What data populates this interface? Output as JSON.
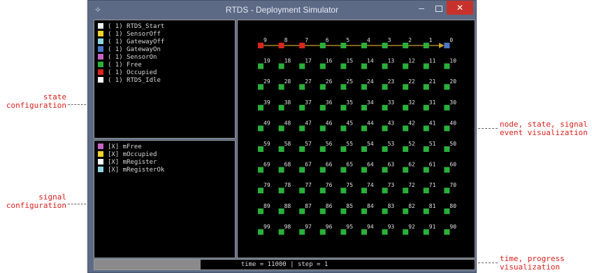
{
  "window": {
    "title": "RTDS - Deployment Simulator"
  },
  "annotations": {
    "state_config": [
      "state",
      "configuration"
    ],
    "signal_config": [
      "signal",
      "configuration"
    ],
    "node_viz": [
      "node, state, signal",
      "event visualization"
    ],
    "time_viz": [
      "time, progress",
      "visualization"
    ]
  },
  "states": [
    {
      "label": "( 1) RTDS_Start",
      "color": "#f2f2f2"
    },
    {
      "label": "( 1) SensorOff",
      "color": "#f2d32b"
    },
    {
      "label": "( 1) GatewayOff",
      "color": "#8ed5e0"
    },
    {
      "label": "( 1) GatewayOn",
      "color": "#4c77c9"
    },
    {
      "label": "( 1) SensorOn",
      "color": "#c564c5"
    },
    {
      "label": "( 1) Free",
      "color": "#29b13a"
    },
    {
      "label": "( 1) Occupied",
      "color": "#d8261d"
    },
    {
      "label": "( 1) RTDS_Idle",
      "color": "#ffffff"
    }
  ],
  "signals": [
    {
      "label": "[X] mFree",
      "color": "#c564c5"
    },
    {
      "label": "[X] mOccupied",
      "color": "#f2d32b"
    },
    {
      "label": "[X] mRegister",
      "color": "#ffffff"
    },
    {
      "label": "[X] mRegisterOk",
      "color": "#8ed5e0"
    }
  ],
  "nodes": {
    "rows": [
      [
        9,
        8,
        7,
        6,
        5,
        4,
        3,
        2,
        1,
        0
      ],
      [
        19,
        18,
        17,
        16,
        15,
        14,
        13,
        12,
        11,
        10
      ],
      [
        29,
        28,
        27,
        26,
        25,
        24,
        23,
        22,
        21,
        20
      ],
      [
        39,
        38,
        37,
        36,
        35,
        34,
        33,
        32,
        31,
        30
      ],
      [
        49,
        48,
        47,
        46,
        45,
        44,
        43,
        42,
        41,
        40
      ],
      [
        59,
        58,
        57,
        56,
        55,
        54,
        53,
        52,
        51,
        50
      ],
      [
        69,
        68,
        67,
        66,
        65,
        64,
        63,
        62,
        61,
        60
      ],
      [
        79,
        78,
        77,
        76,
        75,
        74,
        73,
        72,
        71,
        70
      ],
      [
        89,
        88,
        87,
        86,
        85,
        84,
        83,
        82,
        81,
        80
      ],
      [
        99,
        98,
        97,
        96,
        95,
        94,
        93,
        92,
        91,
        90
      ]
    ],
    "occupied": [
      9,
      8,
      7
    ],
    "gateway_on": [
      0
    ],
    "signal_arrow": {
      "from": 9,
      "to": 0
    }
  },
  "status": {
    "text": "time = 11000 | step = 1",
    "progress": 0.28
  }
}
